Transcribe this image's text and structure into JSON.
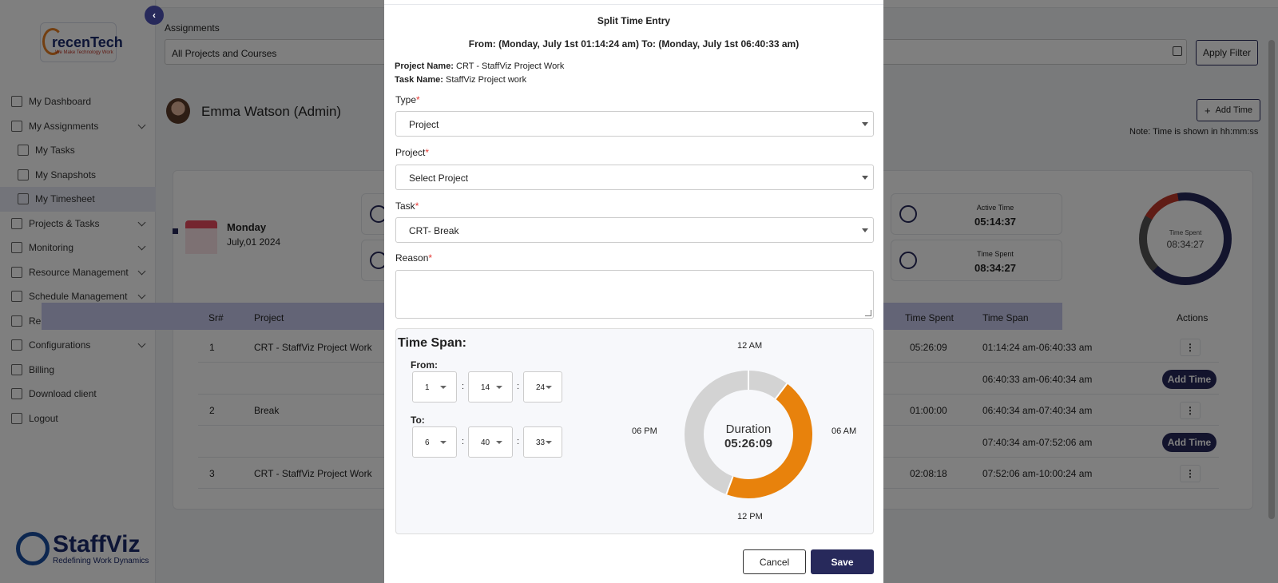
{
  "sidebar": {
    "collapse_icon": "‹",
    "brand_logo": {
      "name": "recenTech",
      "tagline": "We Make Technology Work"
    },
    "items": [
      {
        "label": "My Dashboard",
        "icon": "dashboard-icon",
        "sub": false,
        "chevron": false
      },
      {
        "label": "My Assignments",
        "icon": "assignments-icon",
        "sub": false,
        "chevron": true
      },
      {
        "label": "My Tasks",
        "icon": "tasks-icon",
        "sub": true,
        "chevron": false
      },
      {
        "label": "My Snapshots",
        "icon": "snapshots-icon",
        "sub": true,
        "chevron": false
      },
      {
        "label": "My Timesheet",
        "icon": "timesheet-icon",
        "sub": true,
        "chevron": false,
        "active": true
      },
      {
        "label": "Projects & Tasks",
        "icon": "projects-icon",
        "sub": false,
        "chevron": true
      },
      {
        "label": "Monitoring",
        "icon": "monitoring-icon",
        "sub": false,
        "chevron": true
      },
      {
        "label": "Resource Management",
        "icon": "resource-icon",
        "sub": false,
        "chevron": true
      },
      {
        "label": "Schedule Management",
        "icon": "schedule-icon",
        "sub": false,
        "chevron": true
      },
      {
        "label": "Reports",
        "icon": "reports-icon",
        "sub": false,
        "chevron": true
      },
      {
        "label": "Configurations",
        "icon": "configurations-icon",
        "sub": false,
        "chevron": true
      },
      {
        "label": "Billing",
        "icon": "billing-icon",
        "sub": false,
        "chevron": false
      },
      {
        "label": "Download client",
        "icon": "download-icon",
        "sub": false,
        "chevron": false
      },
      {
        "label": "Logout",
        "icon": "logout-icon",
        "sub": false,
        "chevron": false
      }
    ],
    "footer_logo": {
      "name": "StaffViz",
      "tagline": "Redefining Work Dynamics"
    }
  },
  "main": {
    "assignments_label": "Assignments",
    "filter_value": "All Projects and Courses",
    "apply_filter": "Apply Filter",
    "user_name": "Emma Watson (Admin)",
    "add_time": "Add Time",
    "add_time_icon": "+",
    "note": "Note: Time is shown in hh:mm:ss",
    "day_name": "Monday",
    "day_date": "July,01 2024",
    "stats": [
      {
        "label": "Active Time",
        "value": "05:14:37"
      },
      {
        "label": "Time Spent",
        "value": "08:34:27"
      }
    ],
    "ring": {
      "label": "Time Spent",
      "value": "08:34:27"
    },
    "table": {
      "headers": {
        "sr": "Sr#",
        "project": "Project",
        "time_spent": "Time Spent",
        "time_span": "Time Span",
        "actions": "Actions"
      },
      "rows": [
        {
          "sr": "1",
          "project": "CRT - StaffViz Project Work",
          "time_spent": "05:26:09",
          "time_span": "01:14:24 am-06:40:33 am",
          "action": "⋮"
        },
        {
          "sr": "",
          "project": "",
          "time_spent": "",
          "time_span": "06:40:33 am-06:40:34 am",
          "action": "Add Time"
        },
        {
          "sr": "2",
          "project": "Break",
          "time_spent": "01:00:00",
          "time_span": "06:40:34 am-07:40:34 am",
          "action": "⋮"
        },
        {
          "sr": "",
          "project": "",
          "time_spent": "",
          "time_span": "07:40:34 am-07:52:06 am",
          "action": "Add Time"
        },
        {
          "sr": "3",
          "project": "CRT - StaffViz Project Work",
          "time_spent": "02:08:18",
          "time_span": "07:52:06 am-10:00:24 am",
          "action": "⋮"
        }
      ]
    }
  },
  "modal": {
    "title": "Split Time Entry",
    "range": "From: (Monday, July 1st 01:14:24 am) To: (Monday, July 1st 06:40:33 am)",
    "project_name_label": "Project Name:",
    "project_name": "CRT - StaffViz Project Work",
    "task_name_label": "Task Name:",
    "task_name": "StaffViz Project work",
    "required_mark": "*",
    "type_label": "Type",
    "type_value": "Project",
    "project_label": "Project",
    "project_value": "Select Project",
    "task_label": "Task",
    "task_value": "CRT- Break",
    "reason_label": "Reason",
    "reason_value": "",
    "time_span": {
      "title": "Time Span:",
      "from_label": "From:",
      "to_label": "To:",
      "separator": ":",
      "from": {
        "h": "1",
        "m": "14",
        "s": "24"
      },
      "to": {
        "h": "6",
        "m": "40",
        "s": "33"
      },
      "clock": {
        "top": "12 AM",
        "right": "06 AM",
        "bottom": "12 PM",
        "left": "06 PM"
      },
      "duration_label": "Duration",
      "duration_value": "05:26:09",
      "colors": {
        "track": "#d3d3d3",
        "selected": "#e8820c",
        "gap": "#ffffff"
      }
    },
    "cancel": "Cancel",
    "save": "Save"
  }
}
